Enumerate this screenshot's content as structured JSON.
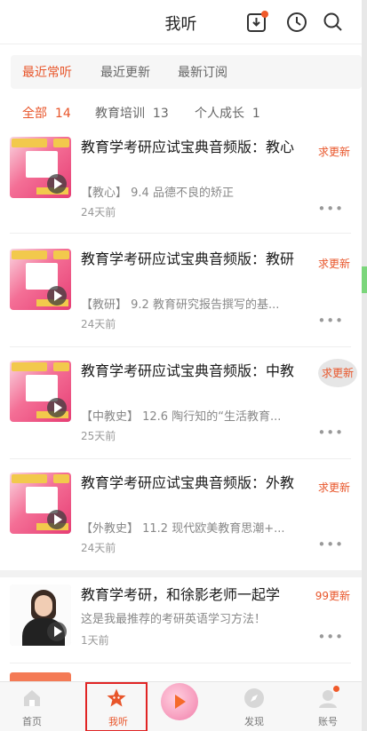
{
  "header": {
    "title": "我听"
  },
  "tabs_primary": [
    {
      "label": "最近常听",
      "active": true
    },
    {
      "label": "最近更新",
      "active": false
    },
    {
      "label": "最新订阅",
      "active": false
    }
  ],
  "tabs_secondary": [
    {
      "label": "全部",
      "count": "14",
      "active": true
    },
    {
      "label": "教育培训",
      "count": "13",
      "active": false
    },
    {
      "label": "个人成长",
      "count": "1",
      "active": false
    }
  ],
  "items": [
    {
      "title": "教育学考研应试宝典音频版：教心",
      "subtitle": "【教心】 9.4 品德不良的矫正",
      "time": "24天前",
      "badge": "求更新"
    },
    {
      "title": "教育学考研应试宝典音频版：教研",
      "subtitle": "【教研】 9.2 教育研究报告撰写的基...",
      "time": "24天前",
      "badge": "求更新"
    },
    {
      "title": "教育学考研应试宝典音频版：中教",
      "subtitle": "【中教史】 12.6 陶行知的“生活教育...",
      "time": "25天前",
      "badge": "求更新"
    },
    {
      "title": "教育学考研应试宝典音频版：外教",
      "subtitle": "【外教史】 11.2 现代欧美教育思潮+...",
      "time": "24天前",
      "badge": "求更新"
    },
    {
      "title": "教育学考研，和徐影老师一起学",
      "subtitle": "这是我最推荐的考研英语学习方法！",
      "time": "1天前",
      "badge": "99更新"
    }
  ],
  "more_label": "•••",
  "nav": [
    {
      "label": "首页"
    },
    {
      "label": "我听"
    },
    {
      "label": ""
    },
    {
      "label": "发现"
    },
    {
      "label": "账号"
    }
  ],
  "colors": {
    "accent": "#e8552a",
    "badge_dot": "#f05a2a"
  }
}
